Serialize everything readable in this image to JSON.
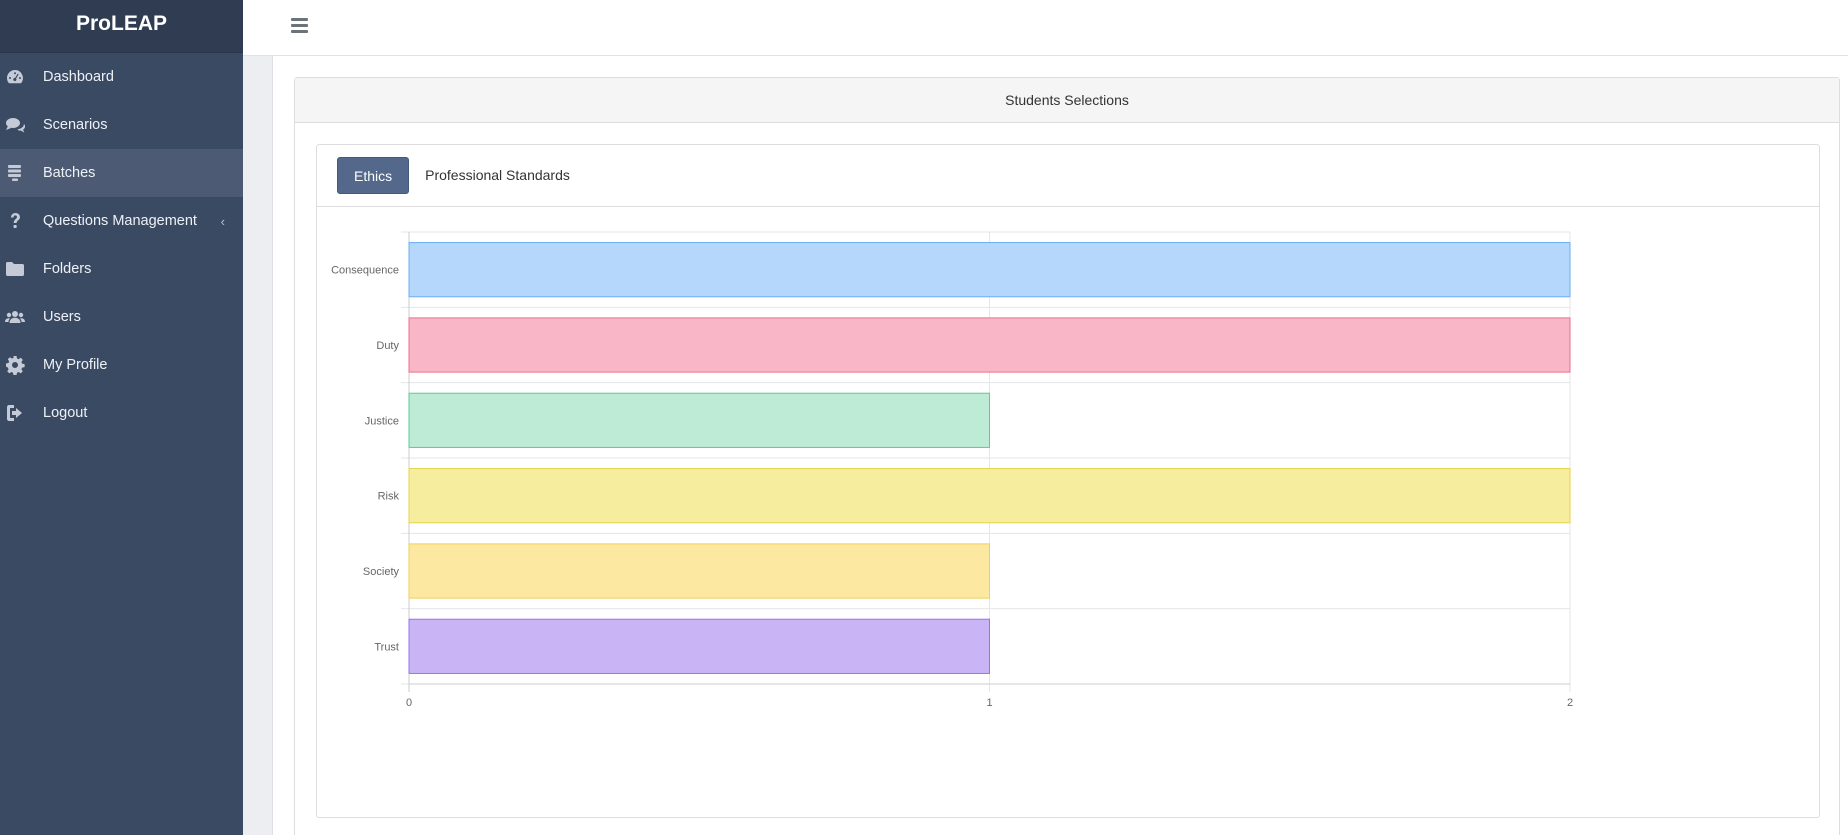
{
  "app": {
    "brand": "ProLEAP"
  },
  "sidebar": {
    "items": [
      {
        "label": "Dashboard",
        "icon": "dashboard-icon",
        "active": false
      },
      {
        "label": "Scenarios",
        "icon": "chat-bubbles-icon",
        "active": false
      },
      {
        "label": "Batches",
        "icon": "list-icon",
        "active": true
      },
      {
        "label": "Questions Management",
        "icon": "question-mark-icon",
        "active": false,
        "caret": "‹"
      },
      {
        "label": "Folders",
        "icon": "folder-icon",
        "active": false
      },
      {
        "label": "Users",
        "icon": "users-icon",
        "active": false
      },
      {
        "label": "My Profile",
        "icon": "gear-icon",
        "active": false
      },
      {
        "label": "Logout",
        "icon": "logout-icon",
        "active": false
      }
    ]
  },
  "panel": {
    "title": "Students Selections",
    "tabs": [
      {
        "label": "Ethics",
        "active": true
      },
      {
        "label": "Professional Standards",
        "active": false
      }
    ]
  },
  "chart_data": {
    "type": "bar",
    "orientation": "horizontal",
    "categories": [
      "Consequence",
      "Duty",
      "Justice",
      "Risk",
      "Society",
      "Trust"
    ],
    "values": [
      2,
      2,
      1,
      2,
      1,
      1
    ],
    "xlim": [
      0,
      2
    ],
    "xticks": [
      "0",
      "1",
      "2"
    ],
    "grid": true,
    "legend": "none",
    "colors": [
      {
        "fill": "#b5d7fb",
        "stroke": "#6aaef3"
      },
      {
        "fill": "#f8b6c6",
        "stroke": "#ec6f8f"
      },
      {
        "fill": "#bdebd5",
        "stroke": "#5fc99a"
      },
      {
        "fill": "#f6ee9e",
        "stroke": "#e4d44a"
      },
      {
        "fill": "#fde8a2",
        "stroke": "#f1cf56"
      },
      {
        "fill": "#c9b5f6",
        "stroke": "#9a72ea"
      }
    ]
  }
}
